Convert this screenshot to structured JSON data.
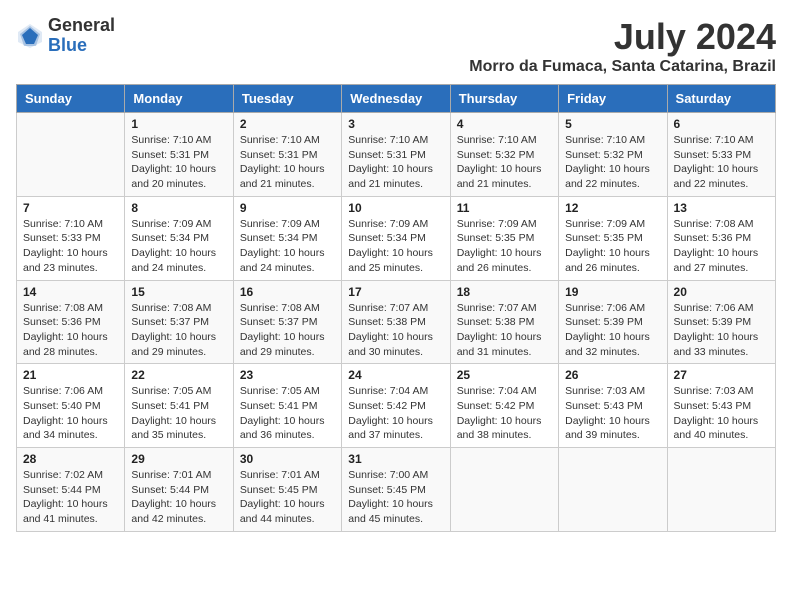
{
  "app": {
    "logo_general": "General",
    "logo_blue": "Blue"
  },
  "header": {
    "month_year": "July 2024",
    "location": "Morro da Fumaca, Santa Catarina, Brazil"
  },
  "days_of_week": [
    "Sunday",
    "Monday",
    "Tuesday",
    "Wednesday",
    "Thursday",
    "Friday",
    "Saturday"
  ],
  "weeks": [
    [
      {
        "day": "",
        "info": ""
      },
      {
        "day": "1",
        "info": "Sunrise: 7:10 AM\nSunset: 5:31 PM\nDaylight: 10 hours\nand 20 minutes."
      },
      {
        "day": "2",
        "info": "Sunrise: 7:10 AM\nSunset: 5:31 PM\nDaylight: 10 hours\nand 21 minutes."
      },
      {
        "day": "3",
        "info": "Sunrise: 7:10 AM\nSunset: 5:31 PM\nDaylight: 10 hours\nand 21 minutes."
      },
      {
        "day": "4",
        "info": "Sunrise: 7:10 AM\nSunset: 5:32 PM\nDaylight: 10 hours\nand 21 minutes."
      },
      {
        "day": "5",
        "info": "Sunrise: 7:10 AM\nSunset: 5:32 PM\nDaylight: 10 hours\nand 22 minutes."
      },
      {
        "day": "6",
        "info": "Sunrise: 7:10 AM\nSunset: 5:33 PM\nDaylight: 10 hours\nand 22 minutes."
      }
    ],
    [
      {
        "day": "7",
        "info": "Sunrise: 7:10 AM\nSunset: 5:33 PM\nDaylight: 10 hours\nand 23 minutes."
      },
      {
        "day": "8",
        "info": "Sunrise: 7:09 AM\nSunset: 5:34 PM\nDaylight: 10 hours\nand 24 minutes."
      },
      {
        "day": "9",
        "info": "Sunrise: 7:09 AM\nSunset: 5:34 PM\nDaylight: 10 hours\nand 24 minutes."
      },
      {
        "day": "10",
        "info": "Sunrise: 7:09 AM\nSunset: 5:34 PM\nDaylight: 10 hours\nand 25 minutes."
      },
      {
        "day": "11",
        "info": "Sunrise: 7:09 AM\nSunset: 5:35 PM\nDaylight: 10 hours\nand 26 minutes."
      },
      {
        "day": "12",
        "info": "Sunrise: 7:09 AM\nSunset: 5:35 PM\nDaylight: 10 hours\nand 26 minutes."
      },
      {
        "day": "13",
        "info": "Sunrise: 7:08 AM\nSunset: 5:36 PM\nDaylight: 10 hours\nand 27 minutes."
      }
    ],
    [
      {
        "day": "14",
        "info": "Sunrise: 7:08 AM\nSunset: 5:36 PM\nDaylight: 10 hours\nand 28 minutes."
      },
      {
        "day": "15",
        "info": "Sunrise: 7:08 AM\nSunset: 5:37 PM\nDaylight: 10 hours\nand 29 minutes."
      },
      {
        "day": "16",
        "info": "Sunrise: 7:08 AM\nSunset: 5:37 PM\nDaylight: 10 hours\nand 29 minutes."
      },
      {
        "day": "17",
        "info": "Sunrise: 7:07 AM\nSunset: 5:38 PM\nDaylight: 10 hours\nand 30 minutes."
      },
      {
        "day": "18",
        "info": "Sunrise: 7:07 AM\nSunset: 5:38 PM\nDaylight: 10 hours\nand 31 minutes."
      },
      {
        "day": "19",
        "info": "Sunrise: 7:06 AM\nSunset: 5:39 PM\nDaylight: 10 hours\nand 32 minutes."
      },
      {
        "day": "20",
        "info": "Sunrise: 7:06 AM\nSunset: 5:39 PM\nDaylight: 10 hours\nand 33 minutes."
      }
    ],
    [
      {
        "day": "21",
        "info": "Sunrise: 7:06 AM\nSunset: 5:40 PM\nDaylight: 10 hours\nand 34 minutes."
      },
      {
        "day": "22",
        "info": "Sunrise: 7:05 AM\nSunset: 5:41 PM\nDaylight: 10 hours\nand 35 minutes."
      },
      {
        "day": "23",
        "info": "Sunrise: 7:05 AM\nSunset: 5:41 PM\nDaylight: 10 hours\nand 36 minutes."
      },
      {
        "day": "24",
        "info": "Sunrise: 7:04 AM\nSunset: 5:42 PM\nDaylight: 10 hours\nand 37 minutes."
      },
      {
        "day": "25",
        "info": "Sunrise: 7:04 AM\nSunset: 5:42 PM\nDaylight: 10 hours\nand 38 minutes."
      },
      {
        "day": "26",
        "info": "Sunrise: 7:03 AM\nSunset: 5:43 PM\nDaylight: 10 hours\nand 39 minutes."
      },
      {
        "day": "27",
        "info": "Sunrise: 7:03 AM\nSunset: 5:43 PM\nDaylight: 10 hours\nand 40 minutes."
      }
    ],
    [
      {
        "day": "28",
        "info": "Sunrise: 7:02 AM\nSunset: 5:44 PM\nDaylight: 10 hours\nand 41 minutes."
      },
      {
        "day": "29",
        "info": "Sunrise: 7:01 AM\nSunset: 5:44 PM\nDaylight: 10 hours\nand 42 minutes."
      },
      {
        "day": "30",
        "info": "Sunrise: 7:01 AM\nSunset: 5:45 PM\nDaylight: 10 hours\nand 44 minutes."
      },
      {
        "day": "31",
        "info": "Sunrise: 7:00 AM\nSunset: 5:45 PM\nDaylight: 10 hours\nand 45 minutes."
      },
      {
        "day": "",
        "info": ""
      },
      {
        "day": "",
        "info": ""
      },
      {
        "day": "",
        "info": ""
      }
    ]
  ]
}
